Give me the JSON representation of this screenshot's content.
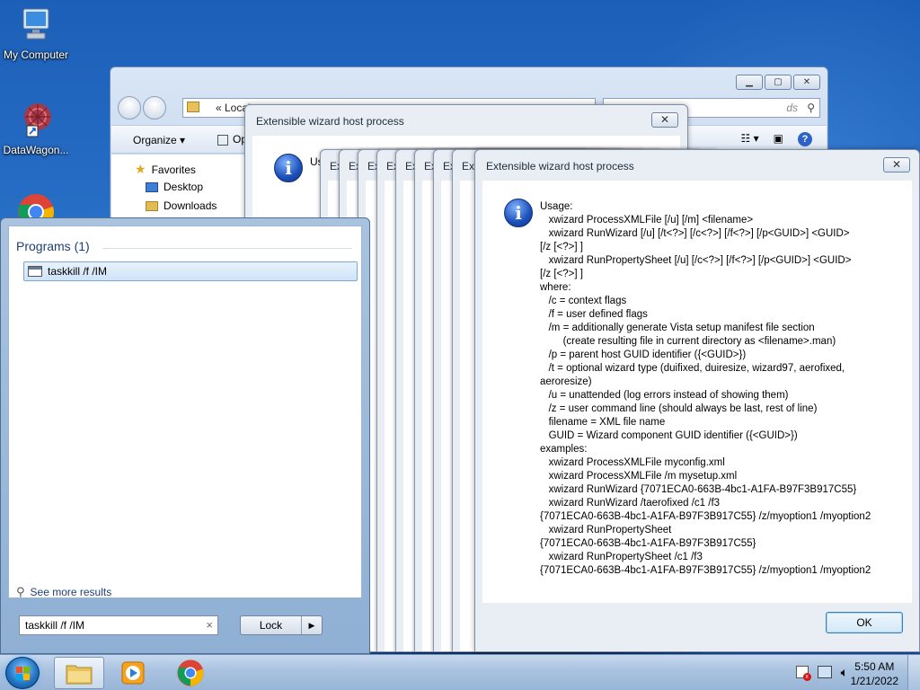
{
  "desktop": {
    "icons": [
      {
        "label": "My Computer"
      },
      {
        "label": "DataWagon..."
      },
      {
        "label": ""
      }
    ]
  },
  "explorer": {
    "address": "«  Local",
    "search_placeholder": "ds",
    "toolbar": {
      "organize": "Organize ▾",
      "second": "Op"
    },
    "nav": {
      "favorites": "Favorites",
      "desktop": "Desktop",
      "downloads": "Downloads"
    }
  },
  "wizard_back": {
    "title": "Extensible wizard host process",
    "usage_snippet": "Us",
    "close": "✕"
  },
  "stacked_dialogs": {
    "prefix": "Ex"
  },
  "wizard_front": {
    "title": "Extensible wizard host process",
    "close": "✕",
    "usage": "Usage:\n   xwizard ProcessXMLFile [/u] [/m] <filename>\n   xwizard RunWizard [/u] [/t<?>] [/c<?>] [/f<?>] [/p<GUID>] <GUID>\n[/z [<?>] ]\n   xwizard RunPropertySheet [/u] [/c<?>] [/f<?>] [/p<GUID>] <GUID>\n[/z [<?>] ]\nwhere:\n   /c = context flags\n   /f = user defined flags\n   /m = additionally generate Vista setup manifest file section\n        (create resulting file in current directory as <filename>.man)\n   /p = parent host GUID identifier ({<GUID>})\n   /t = optional wizard type (duifixed, duiresize, wizard97, aerofixed,\naeroresize)\n   /u = unattended (log errors instead of showing them)\n   /z = user command line (should always be last, rest of line)\n   filename = XML file name\n   GUID = Wizard component GUID identifier ({<GUID>})\nexamples:\n   xwizard ProcessXMLFile myconfig.xml\n   xwizard ProcessXMLFile /m mysetup.xml\n   xwizard RunWizard {7071ECA0-663B-4bc1-A1FA-B97F3B917C55}\n   xwizard RunWizard /taerofixed /c1 /f3\n{7071ECA0-663B-4bc1-A1FA-B97F3B917C55} /z/myoption1 /myoption2\n   xwizard RunPropertySheet\n{7071ECA0-663B-4bc1-A1FA-B97F3B917C55}\n   xwizard RunPropertySheet /c1 /f3\n{7071ECA0-663B-4bc1-A1FA-B97F3B917C55} /z/myoption1 /myoption2",
    "ok_label": "OK"
  },
  "start_menu": {
    "programs_header": "Programs (1)",
    "result_label": "taskkill /f /IM",
    "see_more": "See more results",
    "search_value": "taskkill /f /IM",
    "clear": "×",
    "lock_label": "Lock",
    "lock_arrow": "▶"
  },
  "taskbar": {
    "time": "5:50 AM",
    "date": "1/21/2022"
  }
}
